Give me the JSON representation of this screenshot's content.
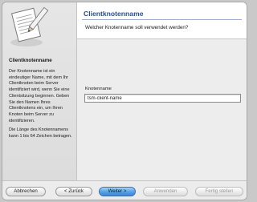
{
  "header": {
    "title": "Clientknotenname",
    "question": "Welcher Knotenname soll verwendet werden?"
  },
  "sidebar": {
    "title": "Clientknotenname",
    "description": "Der Knotenname ist ein eindeutiger Name, mit dem Ihr Clientknoten beim Server identifiziert wird, wenn Sie eine Clientsitzung beginnen. Geben Sie den Namen Ihres Clientknotens ein, um Ihren Knoten beim Server zu identifizieren.",
    "limit": "Die Länge des Knotennamens kann 1 bis 64 Zeichen betragen.",
    "illustration_icon": "document-pencil-icon"
  },
  "form": {
    "node_name_label": "Knotenname",
    "node_name_value": "tsm-client-name"
  },
  "buttons": {
    "cancel": "Abbrechen",
    "back": "< Zurück",
    "next": "Weiter >",
    "apply": "Anwenden",
    "finish": "Fertig stellen"
  },
  "colors": {
    "accent": "#2a4f8f",
    "default_button": "#5aa2ea"
  }
}
